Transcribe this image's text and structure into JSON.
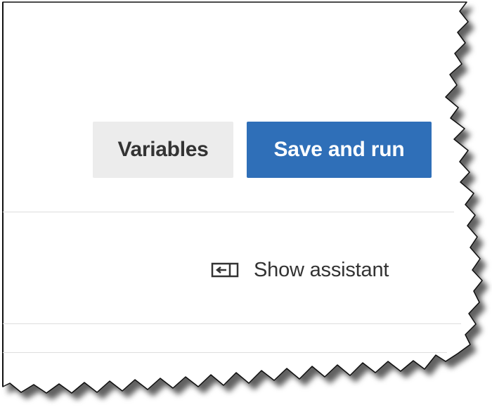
{
  "toolbar": {
    "variables_label": "Variables",
    "save_run_label": "Save and run"
  },
  "assistant": {
    "label": "Show assistant",
    "icon": "show-panel-icon"
  },
  "theme": {
    "primary": "#2f6fb8",
    "secondary": "#ececec",
    "text": "#333333"
  }
}
